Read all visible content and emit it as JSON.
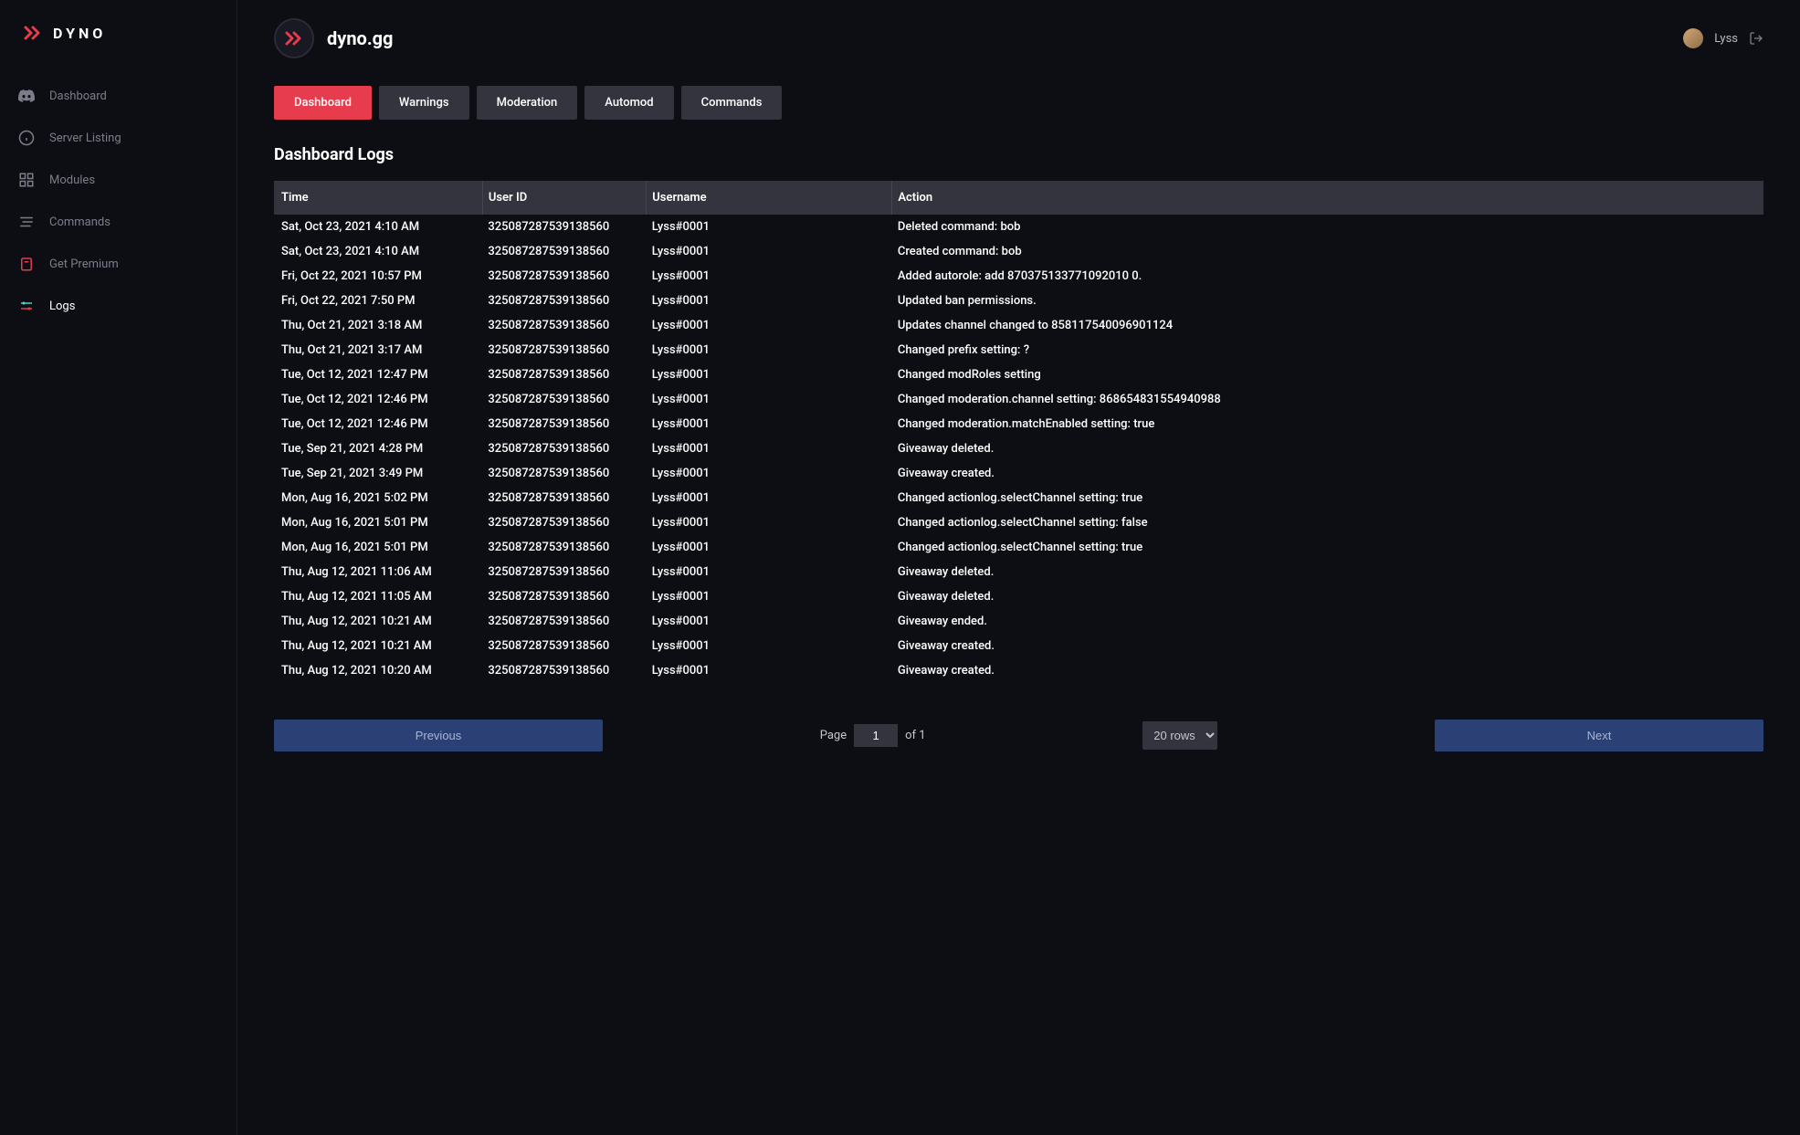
{
  "brand": "DYNO",
  "sidebar": {
    "items": [
      {
        "label": "Dashboard",
        "icon": "discord"
      },
      {
        "label": "Server Listing",
        "icon": "info"
      },
      {
        "label": "Modules",
        "icon": "grid"
      },
      {
        "label": "Commands",
        "icon": "lines"
      },
      {
        "label": "Get Premium",
        "icon": "gift"
      },
      {
        "label": "Logs",
        "icon": "sliders",
        "active": true
      }
    ]
  },
  "header": {
    "server_name": "dyno.gg",
    "username": "Lyss"
  },
  "tabs": [
    {
      "label": "Dashboard",
      "active": true
    },
    {
      "label": "Warnings"
    },
    {
      "label": "Moderation"
    },
    {
      "label": "Automod"
    },
    {
      "label": "Commands"
    }
  ],
  "page_title": "Dashboard Logs",
  "table": {
    "headers": {
      "time": "Time",
      "user_id": "User ID",
      "username": "Username",
      "action": "Action"
    },
    "rows": [
      {
        "time": "Sat, Oct 23, 2021 4:10 AM",
        "user_id": "325087287539138560",
        "username": "Lyss#0001",
        "action": "Deleted command: bob"
      },
      {
        "time": "Sat, Oct 23, 2021 4:10 AM",
        "user_id": "325087287539138560",
        "username": "Lyss#0001",
        "action": "Created command: bob"
      },
      {
        "time": "Fri, Oct 22, 2021 10:57 PM",
        "user_id": "325087287539138560",
        "username": "Lyss#0001",
        "action": "Added autorole: add 870375133771092010 0."
      },
      {
        "time": "Fri, Oct 22, 2021 7:50 PM",
        "user_id": "325087287539138560",
        "username": "Lyss#0001",
        "action": "Updated ban permissions."
      },
      {
        "time": "Thu, Oct 21, 2021 3:18 AM",
        "user_id": "325087287539138560",
        "username": "Lyss#0001",
        "action": "Updates channel changed to 858117540096901124"
      },
      {
        "time": "Thu, Oct 21, 2021 3:17 AM",
        "user_id": "325087287539138560",
        "username": "Lyss#0001",
        "action": "Changed prefix setting: ?"
      },
      {
        "time": "Tue, Oct 12, 2021 12:47 PM",
        "user_id": "325087287539138560",
        "username": "Lyss#0001",
        "action": "Changed modRoles setting"
      },
      {
        "time": "Tue, Oct 12, 2021 12:46 PM",
        "user_id": "325087287539138560",
        "username": "Lyss#0001",
        "action": "Changed moderation.channel setting: 868654831554940988"
      },
      {
        "time": "Tue, Oct 12, 2021 12:46 PM",
        "user_id": "325087287539138560",
        "username": "Lyss#0001",
        "action": "Changed moderation.matchEnabled setting: true"
      },
      {
        "time": "Tue, Sep 21, 2021 4:28 PM",
        "user_id": "325087287539138560",
        "username": "Lyss#0001",
        "action": "Giveaway deleted."
      },
      {
        "time": "Tue, Sep 21, 2021 3:49 PM",
        "user_id": "325087287539138560",
        "username": "Lyss#0001",
        "action": "Giveaway created."
      },
      {
        "time": "Mon, Aug 16, 2021 5:02 PM",
        "user_id": "325087287539138560",
        "username": "Lyss#0001",
        "action": "Changed actionlog.selectChannel setting: true"
      },
      {
        "time": "Mon, Aug 16, 2021 5:01 PM",
        "user_id": "325087287539138560",
        "username": "Lyss#0001",
        "action": "Changed actionlog.selectChannel setting: false"
      },
      {
        "time": "Mon, Aug 16, 2021 5:01 PM",
        "user_id": "325087287539138560",
        "username": "Lyss#0001",
        "action": "Changed actionlog.selectChannel setting: true"
      },
      {
        "time": "Thu, Aug 12, 2021 11:06 AM",
        "user_id": "325087287539138560",
        "username": "Lyss#0001",
        "action": "Giveaway deleted."
      },
      {
        "time": "Thu, Aug 12, 2021 11:05 AM",
        "user_id": "325087287539138560",
        "username": "Lyss#0001",
        "action": "Giveaway deleted."
      },
      {
        "time": "Thu, Aug 12, 2021 10:21 AM",
        "user_id": "325087287539138560",
        "username": "Lyss#0001",
        "action": "Giveaway ended."
      },
      {
        "time": "Thu, Aug 12, 2021 10:21 AM",
        "user_id": "325087287539138560",
        "username": "Lyss#0001",
        "action": "Giveaway created."
      },
      {
        "time": "Thu, Aug 12, 2021 10:20 AM",
        "user_id": "325087287539138560",
        "username": "Lyss#0001",
        "action": "Giveaway created."
      }
    ]
  },
  "pagination": {
    "prev_label": "Previous",
    "next_label": "Next",
    "page_label": "Page",
    "current_page": "1",
    "of_label": "of 1",
    "rows_label": "20 rows"
  }
}
